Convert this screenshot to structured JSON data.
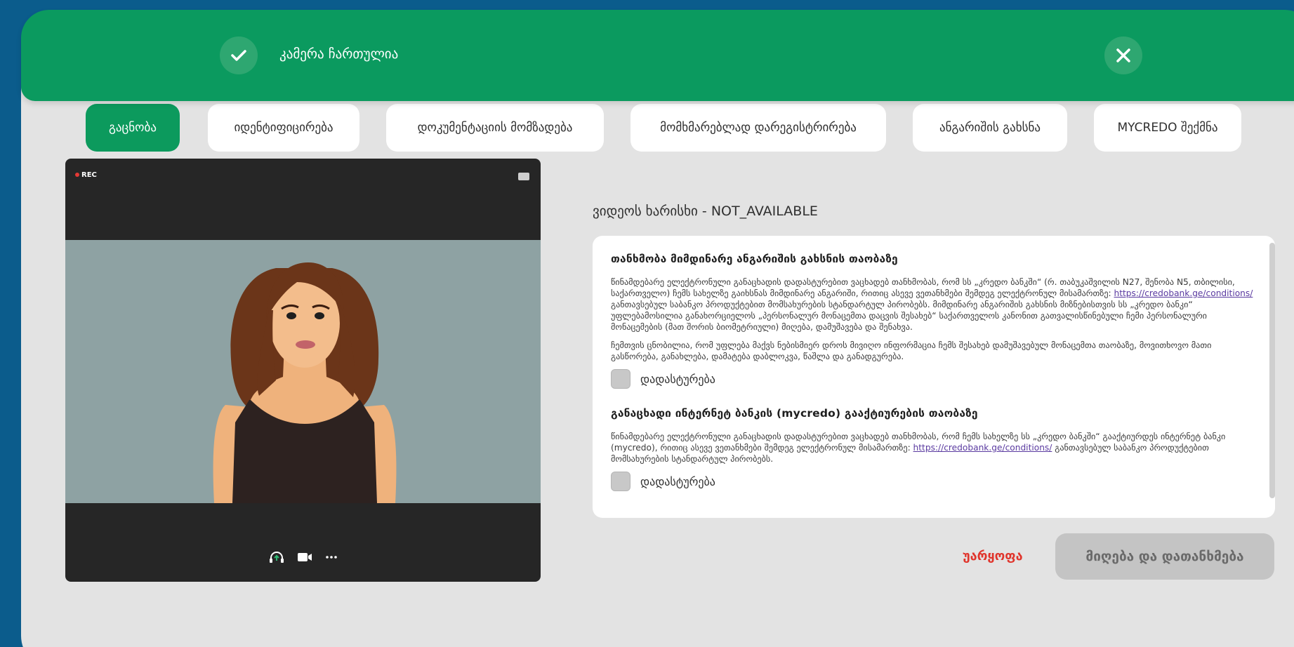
{
  "toast": {
    "message": "კამერა ჩართულია"
  },
  "steps": [
    "გაცნობა",
    "იდენტიფიცირება",
    "დოკუმენტაციის მომზადება",
    "მომხმარებლად დარეგისტრირება",
    "ანგარიშის გახსნა",
    "MYCREDO შექმნა"
  ],
  "video": {
    "rec_label": "REC"
  },
  "quality_label": "ვიდეოს ხარისხი - NOT_AVAILABLE",
  "consent": {
    "section1": {
      "title": "თანხმობა მიმდინარე ანგარიშის გახსნის თაობაზე",
      "p1_before_link": "წინამდებარე ელექტრონული განაცხადის დადასტურებით ვაცხადებ თანხმობას, რომ სს „კრედო ბანკში“ (რ. თაბუკაშვილის N27, შენობა N5, თბილისი, საქართველო) ჩემს სახელზე გაიხსნას მიმდინარე ანგარიში, რითიც ასევე ვეთანხმები შემდეგ ელექტრონულ მისამართზე:",
      "p1_link": "https://credobank.ge/conditions/",
      "p1_after_link": "განთავსებულ საბანკო პროდუქტებით მომსახურების სტანდარტულ პირობებს. მიმდინარე ანგარიშის გახსნის მიზნებისთვის სს „კრედო ბანკი“ უფლებამოსილია განახორციელოს „პერსონალურ მონაცემთა დაცვის შესახებ“ საქართველოს კანონით გათვალისწინებული ჩემი პერსონალური მონაცემების (მათ შორის ბიომეტრიული) მიღება, დამუშავება და შენახვა.",
      "p2": "ჩემთვის ცნობილია, რომ უფლება მაქვს ნებისმიერ დროს მივიღო ინფორმაცია ჩემს შესახებ დამუშავებულ მონაცემთა თაობაზე, მოვითხოვო მათი გასწორება, განახლება, დამატება დაბლოკვა, წაშლა და განადგურება.",
      "check_label": "დადასტურება"
    },
    "section2": {
      "title": "განაცხადი ინტერნეტ ბანკის (mycredo) გააქტიურების თაობაზე",
      "p1_before_link": "წინამდებარე ელექტრონული განაცხადის დადასტურებით ვაცხადებ თანხმობას, რომ ჩემს სახელზე სს „კრედო ბანკში“ გააქტიურდეს ინტერნეტ ბანკი (mycredo), რითიც ასევე ვეთანხმები შემდეგ ელექტრონულ მისამართზე:",
      "p1_link": "https://credobank.ge/conditions/",
      "p1_after_link": "განთავსებულ საბანკო პროდუქტებით მომსახურების სტანდარტულ პირობებს.",
      "check_label": "დადასტურება"
    }
  },
  "actions": {
    "reject": "უარყოფა",
    "accept": "მიღება და დათანხმება"
  },
  "colors": {
    "brand_green": "#0c9a5d",
    "reject_red": "#e0342b",
    "background_blue": "#0b5c8c"
  }
}
